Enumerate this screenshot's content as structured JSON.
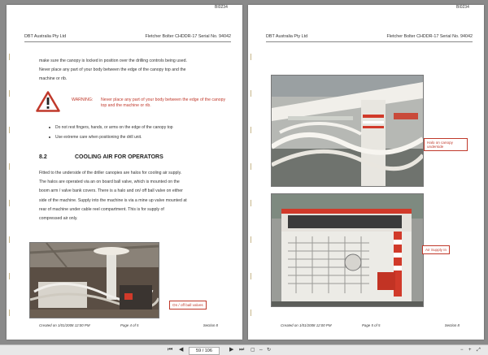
{
  "doc_id": "BI0234",
  "header": {
    "company": "DBT Australia Pty Ltd",
    "model": "Fletcher Bolter CHDDR-17 Serial No. 94042"
  },
  "left_page": {
    "intro_lines": [
      "make sure the canopy is locked in position over the drilling controls being used.",
      "Never place any part of your body between the edge of the canopy top and the",
      "machine or rib."
    ],
    "warning_label": "WARNING:",
    "warning_text": "Never place any part of your body between the edge of the canopy top and the machine or rib.",
    "bullets": [
      "Do not rest fingers, hands, or arms on the edge of the canopy top",
      "Use extreme care when positioning the drill unit."
    ],
    "section_number": "8.2",
    "section_title": "COOLING AIR FOR OPERATORS",
    "body_lines": [
      "Fitted to the underside of the driller canopies are halos for cooling air supply.",
      "The halos are operated via an on board ball valve, which is mounted on the",
      "boom arm / valve bank covers. There is a halo and on/ off ball valve on either",
      "side of the machine. Supply into the machine is via a mine up valve mounted at",
      "rear of machine under cable reel compartment. This is for supply of",
      "compressed air only."
    ],
    "photo_callout": "On / off ball valves",
    "footer": {
      "created": "Created on 1/01/2008 12:00 PM",
      "page": "Page 4 of 5",
      "section": "Section 8"
    }
  },
  "right_page": {
    "photo1_callout": "Halo on canopy underside",
    "photo2_callout": "Air Supply In",
    "footer": {
      "created": "Created on 1/01/2008 12:00 PM",
      "page": "Page 5 of 5",
      "section": "Section 8"
    }
  },
  "toolbar": {
    "current_page": "59 / 106",
    "first": "⏮",
    "prev": "◀",
    "next": "▶",
    "last": "⏭"
  },
  "colors": {
    "warning": "#c0392b",
    "viewer_bg": "#8a8a8a"
  }
}
